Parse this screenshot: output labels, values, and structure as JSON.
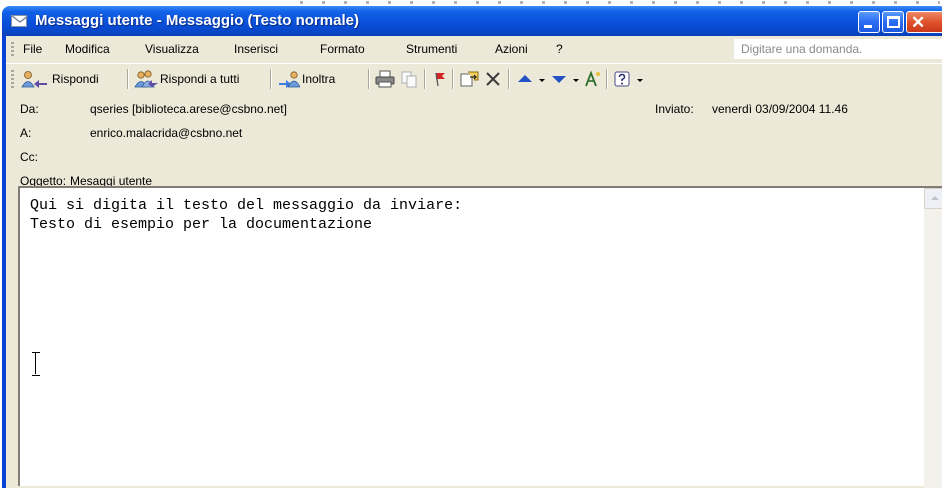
{
  "window": {
    "title": "Messaggi utente - Messaggio (Testo normale)",
    "minimize_icon": "minimize-icon",
    "maximize_icon": "maximize-icon",
    "close_icon": "close-icon",
    "close_glyph": "✕"
  },
  "menu": {
    "items": [
      "File",
      "Modifica",
      "Visualizza",
      "Inserisci",
      "Formato",
      "Strumenti",
      "Azioni",
      "?"
    ],
    "help_placeholder": "Digitare una domanda."
  },
  "toolbar": {
    "reply_label": "Rispondi",
    "reply_all_label": "Rispondi a tutti",
    "forward_label": "Inoltra"
  },
  "headers": {
    "from_label": "Da:",
    "from_value": "qseries [biblioteca.arese@csbno.net]",
    "to_label": "A:",
    "to_value": "enrico.malacrida@csbno.net",
    "cc_label": "Cc:",
    "cc_value": "",
    "subject_label": "Oggetto:",
    "subject_value": "Mesaggi utente",
    "sent_label": "Inviato:",
    "sent_value": "venerdì 03/09/2004 11.46"
  },
  "body": {
    "text": "Qui si digita il testo del messaggio da inviare:\nTesto di esempio per la documentazione"
  },
  "colors": {
    "titlebar": "#0a50db",
    "window_frame": "#0842d6",
    "chrome": "#ece9d8",
    "close_button": "#e0532d"
  }
}
